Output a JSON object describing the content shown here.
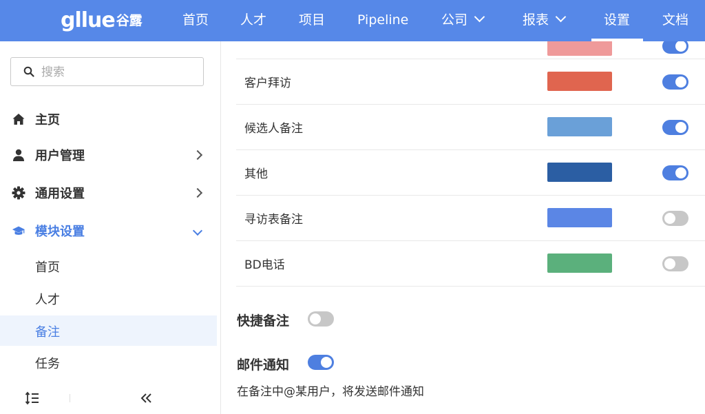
{
  "brand": {
    "logo_text": "gllue",
    "logo_cn": "谷露"
  },
  "nav": {
    "items": [
      {
        "label": "首页"
      },
      {
        "label": "人才"
      },
      {
        "label": "项目"
      },
      {
        "label": "Pipeline"
      },
      {
        "label": "公司",
        "has_dropdown": true
      },
      {
        "label": "报表",
        "has_dropdown": true
      },
      {
        "label": "设置",
        "active": true
      },
      {
        "label": "文档"
      }
    ]
  },
  "sidebar": {
    "search_placeholder": "搜索",
    "menu": [
      {
        "label": "主页",
        "icon": "home-icon"
      },
      {
        "label": "用户管理",
        "icon": "user-icon",
        "arrow": "right"
      },
      {
        "label": "通用设置",
        "icon": "gear-icon",
        "arrow": "right"
      },
      {
        "label": "模块设置",
        "icon": "graduation-cap-icon",
        "arrow": "down",
        "active": true
      }
    ],
    "submenu": [
      {
        "label": "首页"
      },
      {
        "label": "人才"
      },
      {
        "label": "备注",
        "selected": true
      },
      {
        "label": "任务"
      }
    ],
    "bottom": {
      "sort_icon": "sort-icon",
      "collapse_icon": "double-chevron-left-icon"
    }
  },
  "note_types": [
    {
      "label": "客户拜访",
      "color": "#e0654f",
      "enabled": true
    },
    {
      "label": "候选人备注",
      "color": "#6aa0d8",
      "enabled": true
    },
    {
      "label": "其他",
      "color": "#2b5ea3",
      "enabled": true
    },
    {
      "label": "寻访表备注",
      "color": "#5b86e5",
      "enabled": false
    },
    {
      "label": "BD电话",
      "color": "#5bb07c",
      "enabled": false
    }
  ],
  "partial_row": {
    "color": "#ef9a9a",
    "enabled": true
  },
  "settings": {
    "quick_note": {
      "label": "快捷备注",
      "enabled": false
    },
    "email_notify": {
      "label": "邮件通知",
      "enabled": true,
      "description": "在备注中@某用户，将发送邮件通知"
    }
  },
  "colors": {
    "accent": "#5688e8",
    "toggle_on": "#4e7fe0",
    "toggle_off": "#c7c7c7",
    "active_text": "#4a7fe3"
  }
}
